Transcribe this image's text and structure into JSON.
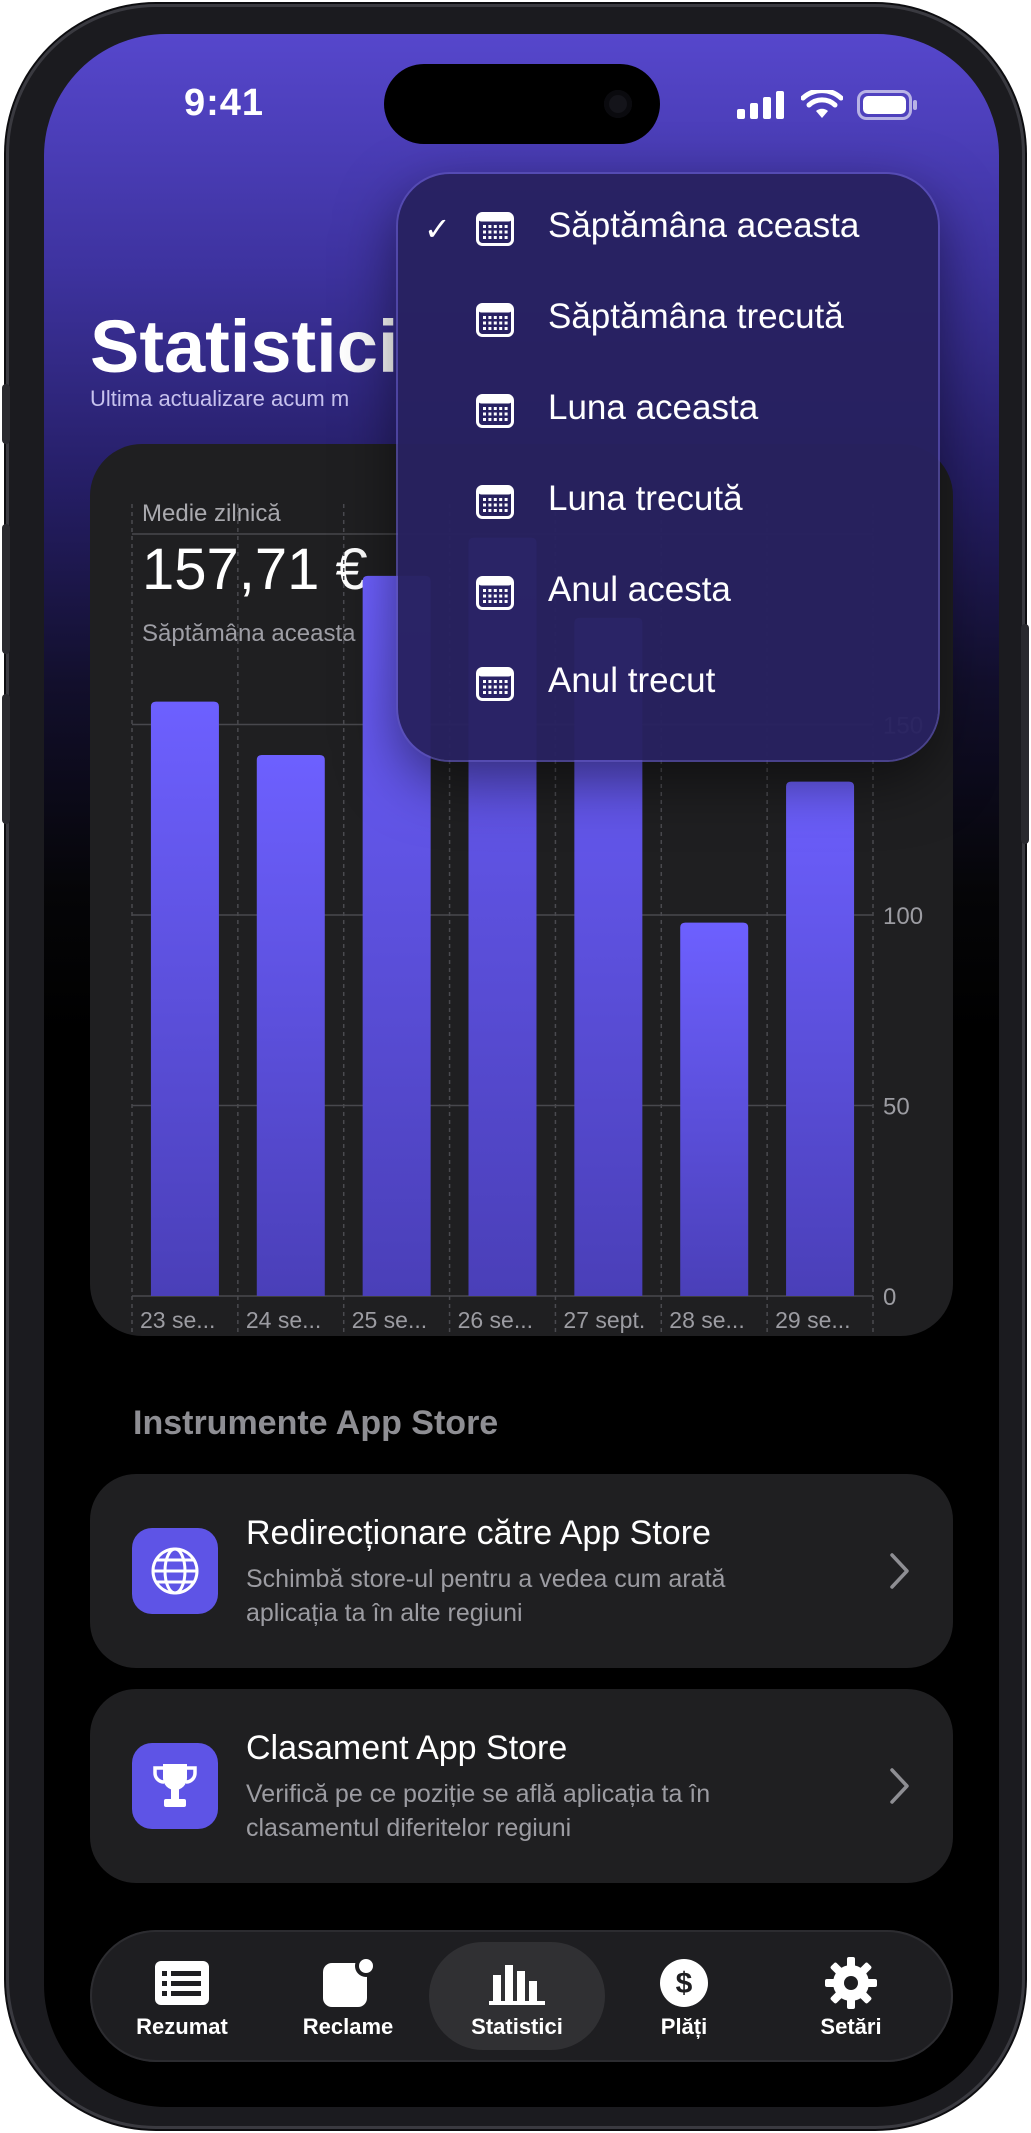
{
  "status_bar": {
    "time": "9:41"
  },
  "header": {
    "title": "Statistici",
    "subtitle": "Ultima actualizare acum m"
  },
  "summary": {
    "label": "Medie zilnică",
    "value": "157,71 €",
    "period": "Săptămâna aceasta"
  },
  "chart_data": {
    "type": "bar",
    "categories": [
      "23 se...",
      "24 se...",
      "25 se...",
      "26 se...",
      "27 sept.",
      "28 se...",
      "29 se..."
    ],
    "values": [
      156,
      142,
      189,
      199,
      178,
      98,
      135
    ],
    "ylim": [
      0,
      200
    ],
    "yticks": [
      "0",
      "50",
      "100",
      "150"
    ],
    "bar_color": "#6d60ff",
    "grid": true,
    "y_axis_side": "right"
  },
  "section": {
    "title": "Instrumente App Store"
  },
  "tools": [
    {
      "title": "Redirecționare către App Store",
      "description": "Schimbă store-ul pentru a vedea cum arată aplicația ta în alte regiuni",
      "icon": "globe-icon"
    },
    {
      "title": "Clasament App Store",
      "description": "Verifică pe ce poziție se află aplicația ta în clasamentul diferitelor regiuni",
      "icon": "trophy-icon"
    }
  ],
  "tabs": [
    {
      "label": "Rezumat",
      "icon": "list-icon",
      "active": false
    },
    {
      "label": "Reclame",
      "icon": "ads-icon",
      "active": false
    },
    {
      "label": "Statistici",
      "icon": "chart-icon",
      "active": true
    },
    {
      "label": "Plăți",
      "icon": "dollar-icon",
      "active": false
    },
    {
      "label": "Setări",
      "icon": "gear-icon",
      "active": false
    }
  ],
  "period_menu": {
    "selected": "Săptămâna aceasta",
    "check_symbol": "✓",
    "items": [
      "Săptămâna aceasta",
      "Săptămâna trecută",
      "Luna aceasta",
      "Luna trecută",
      "Anul acesta",
      "Anul trecut"
    ]
  },
  "colors": {
    "accent": "#5e54e6",
    "card": "#1f1f21",
    "menu": "#282160"
  }
}
